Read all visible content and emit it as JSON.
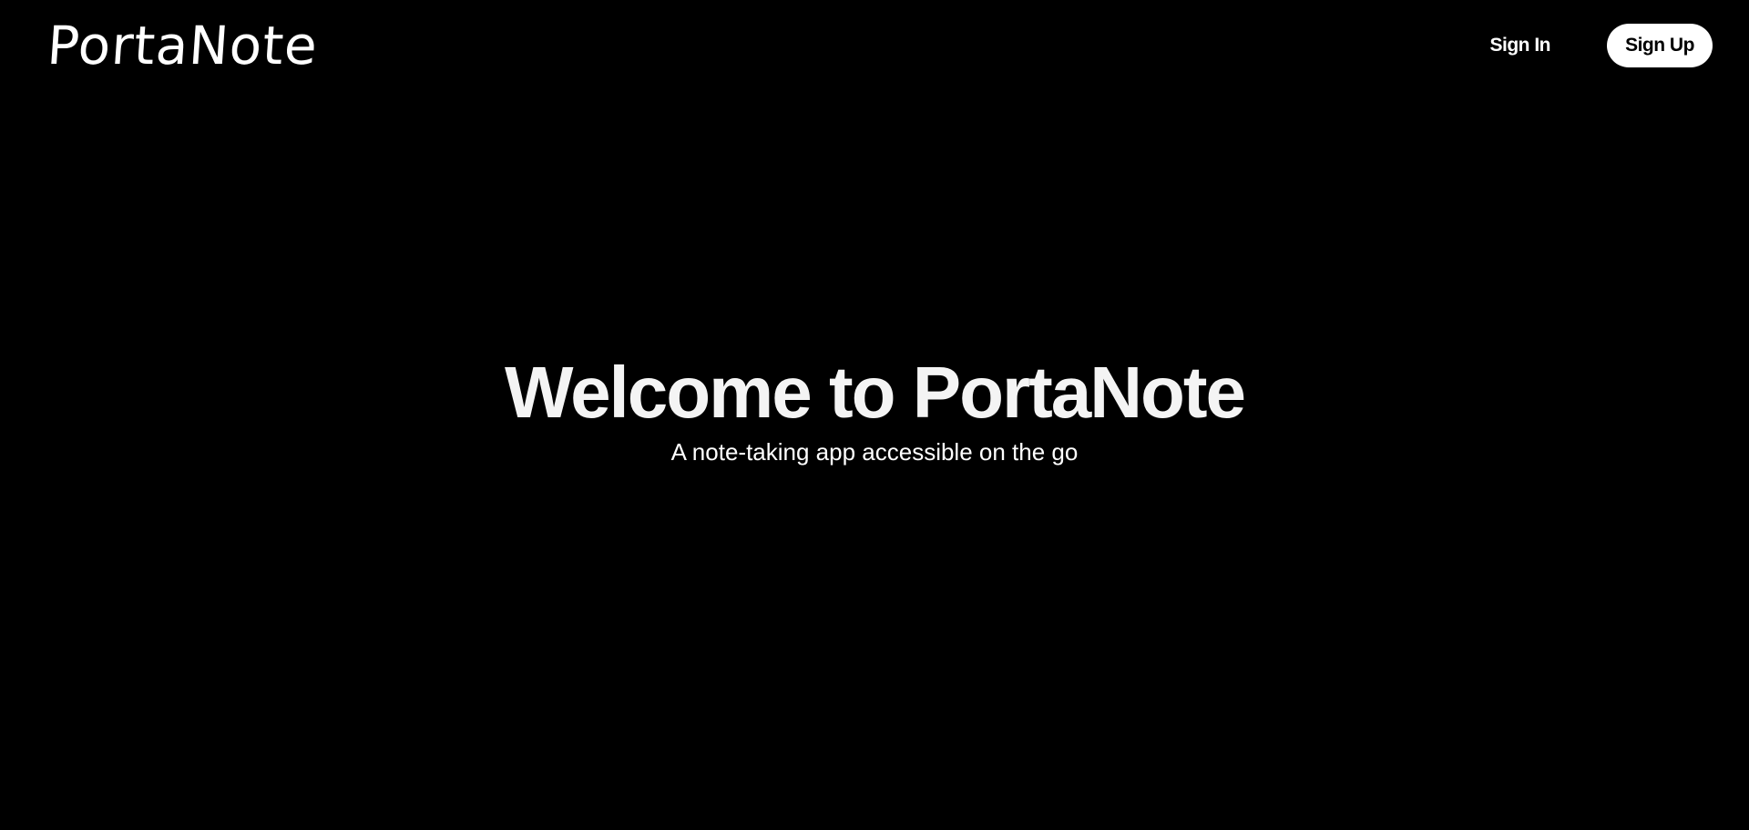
{
  "navbar": {
    "logo_text": "PortaNote",
    "sign_in_label": "Sign In",
    "sign_up_label": "Sign Up"
  },
  "hero": {
    "title": "Welcome to PortaNote",
    "subtitle": "A note-taking app accessible on the go"
  },
  "colors": {
    "background": "#000000",
    "text": "#ffffff",
    "button_bg": "#ffffff",
    "button_text": "#000000"
  }
}
